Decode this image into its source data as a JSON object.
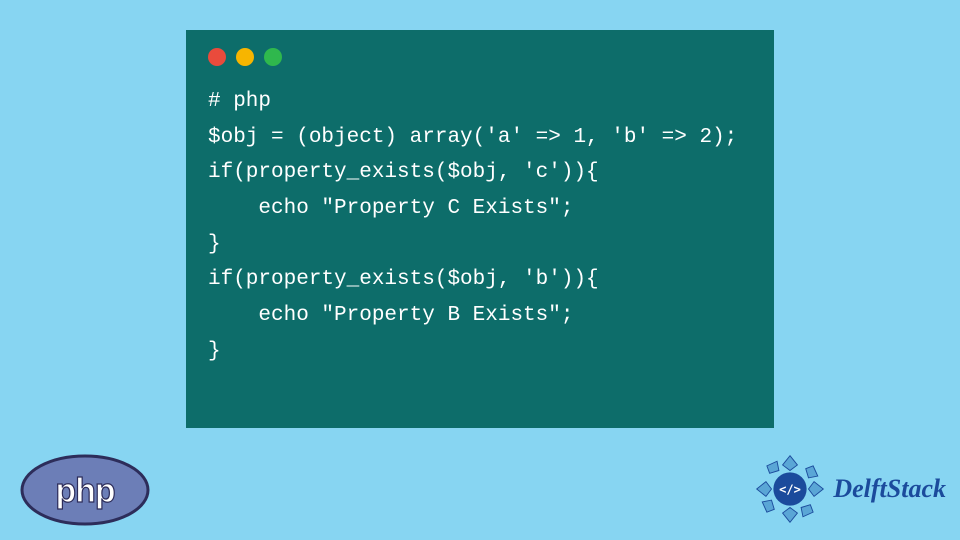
{
  "code": {
    "lines": [
      "# php",
      "$obj = (object) array('a' => 1, 'b' => 2);",
      "if(property_exists($obj, 'c')){",
      "    echo \"Property C Exists\";",
      "}",
      "if(property_exists($obj, 'b')){",
      "    echo \"Property B Exists\";",
      "}"
    ]
  },
  "logos": {
    "php": "php",
    "brand": "DelftStack"
  },
  "colors": {
    "page_bg": "#87d5f2",
    "code_bg": "#0d6d6a",
    "code_fg": "#ffffff",
    "dot_red": "#e94b3c",
    "dot_yellow": "#f7b500",
    "dot_green": "#2fb84d",
    "php_fill": "#6c7eb7",
    "brand_color": "#1b4b9c"
  }
}
